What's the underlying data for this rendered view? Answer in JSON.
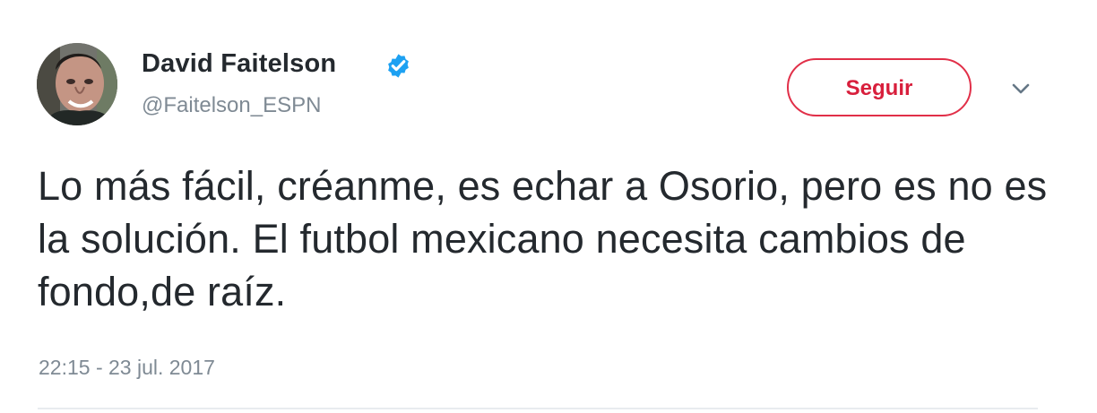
{
  "tweet": {
    "author": {
      "name": "David Faitelson",
      "handle": "@Faitelson_ESPN",
      "verified": true,
      "avatar_icon": "profile-photo"
    },
    "follow_button": {
      "label": "Seguir",
      "color": "#d81f3c"
    },
    "menu_icon": "chevron-down-icon",
    "text": "Lo más fácil, créanme, es echar a Osorio, pero es no es la solución. El futbol mexicano necesita cambios de fondo,de raíz.",
    "timestamp": "22:15 - 23 jul. 2017"
  },
  "colors": {
    "verified": "#1da1f2",
    "text": "#24292e",
    "secondary_text": "#7f8a94",
    "divider": "#e8ecef"
  }
}
